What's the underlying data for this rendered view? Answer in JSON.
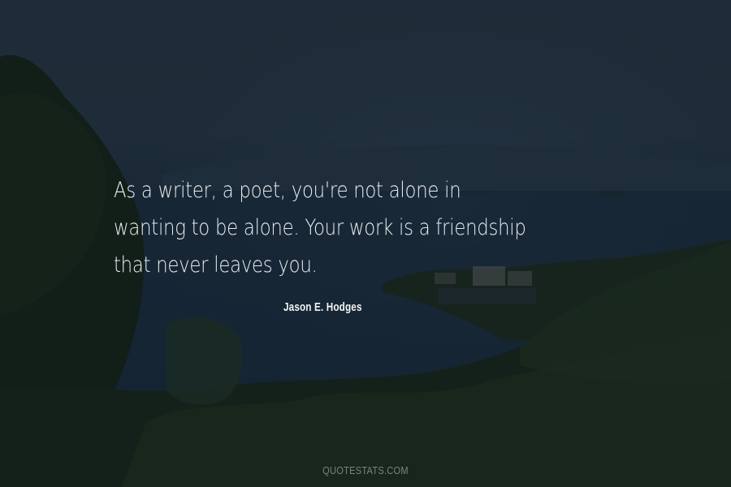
{
  "quote": {
    "lines": [
      "As a writer, a poet, you're not alone in",
      "wanting to be alone. Your work is a friendship",
      "that never leaves you."
    ]
  },
  "author": "Jason E. Hodges",
  "watermark": "QUOTESTATS.COM",
  "colors": {
    "text": "#e9ecef",
    "sky": "#2b3a4a",
    "water": "#1f3347",
    "foliage": "#1a2a1c"
  }
}
